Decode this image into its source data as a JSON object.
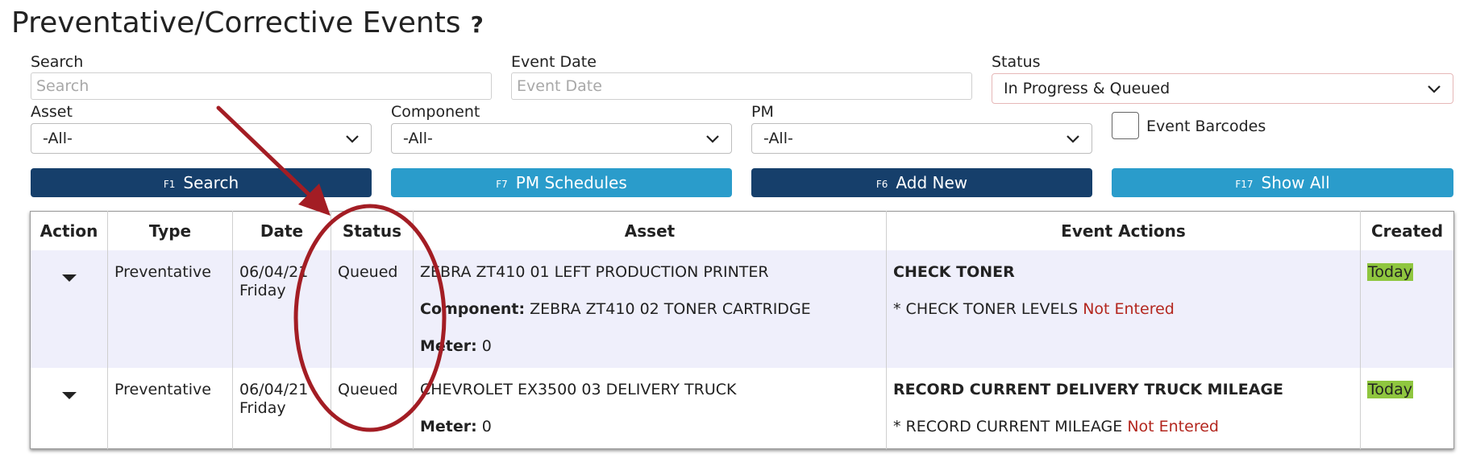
{
  "page": {
    "title": "Preventative/Corrective Events",
    "help": "?"
  },
  "filters": {
    "search": {
      "label": "Search",
      "placeholder": "Search",
      "value": ""
    },
    "event_date": {
      "label": "Event Date",
      "placeholder": "Event Date",
      "value": ""
    },
    "status": {
      "label": "Status",
      "value": "In Progress & Queued"
    },
    "asset": {
      "label": "Asset",
      "value": "-All-"
    },
    "component": {
      "label": "Component",
      "value": "-All-"
    },
    "pm": {
      "label": "PM",
      "value": "-All-"
    },
    "event_barcodes": {
      "label": "Event Barcodes",
      "checked": false
    }
  },
  "buttons": [
    {
      "key": "F1",
      "label": "Search",
      "color": "#163f6b"
    },
    {
      "key": "F7",
      "label": "PM Schedules",
      "color": "#2a9ccb"
    },
    {
      "key": "F6",
      "label": "Add New",
      "color": "#163f6b"
    },
    {
      "key": "F17",
      "label": "Show All",
      "color": "#2a9ccb"
    }
  ],
  "table": {
    "headers": [
      "Action",
      "Type",
      "Date",
      "Status",
      "Asset",
      "Event Actions",
      "Created"
    ],
    "rows": [
      {
        "type": "Preventative",
        "date": "06/04/21",
        "day": "Friday",
        "status": "Queued",
        "asset": "ZEBRA ZT410 01 LEFT PRODUCTION PRINTER",
        "component_label": "Component:",
        "component": "ZEBRA ZT410 02 TONER CARTRIDGE",
        "meter_label": "Meter:",
        "meter": "0",
        "event_title": "CHECK TONER",
        "action_bullet": "*",
        "action_text": "CHECK TONER LEVELS",
        "action_status": "Not Entered",
        "created": "Today"
      },
      {
        "type": "Preventative",
        "date": "06/04/21",
        "day": "Friday",
        "status": "Queued",
        "asset": "CHEVROLET EX3500 03 DELIVERY TRUCK",
        "meter_label": "Meter:",
        "meter": "0",
        "event_title": "RECORD CURRENT DELIVERY TRUCK MILEAGE",
        "action_bullet": "*",
        "action_text": "RECORD CURRENT MILEAGE",
        "action_status": "Not Entered",
        "created": "Today"
      }
    ]
  },
  "colors": {
    "dark_button": "#163f6b",
    "light_button": "#2a9ccb",
    "not_entered": "#b3261e",
    "today_badge": "#8fc63f",
    "annotation": "#a31d24"
  }
}
